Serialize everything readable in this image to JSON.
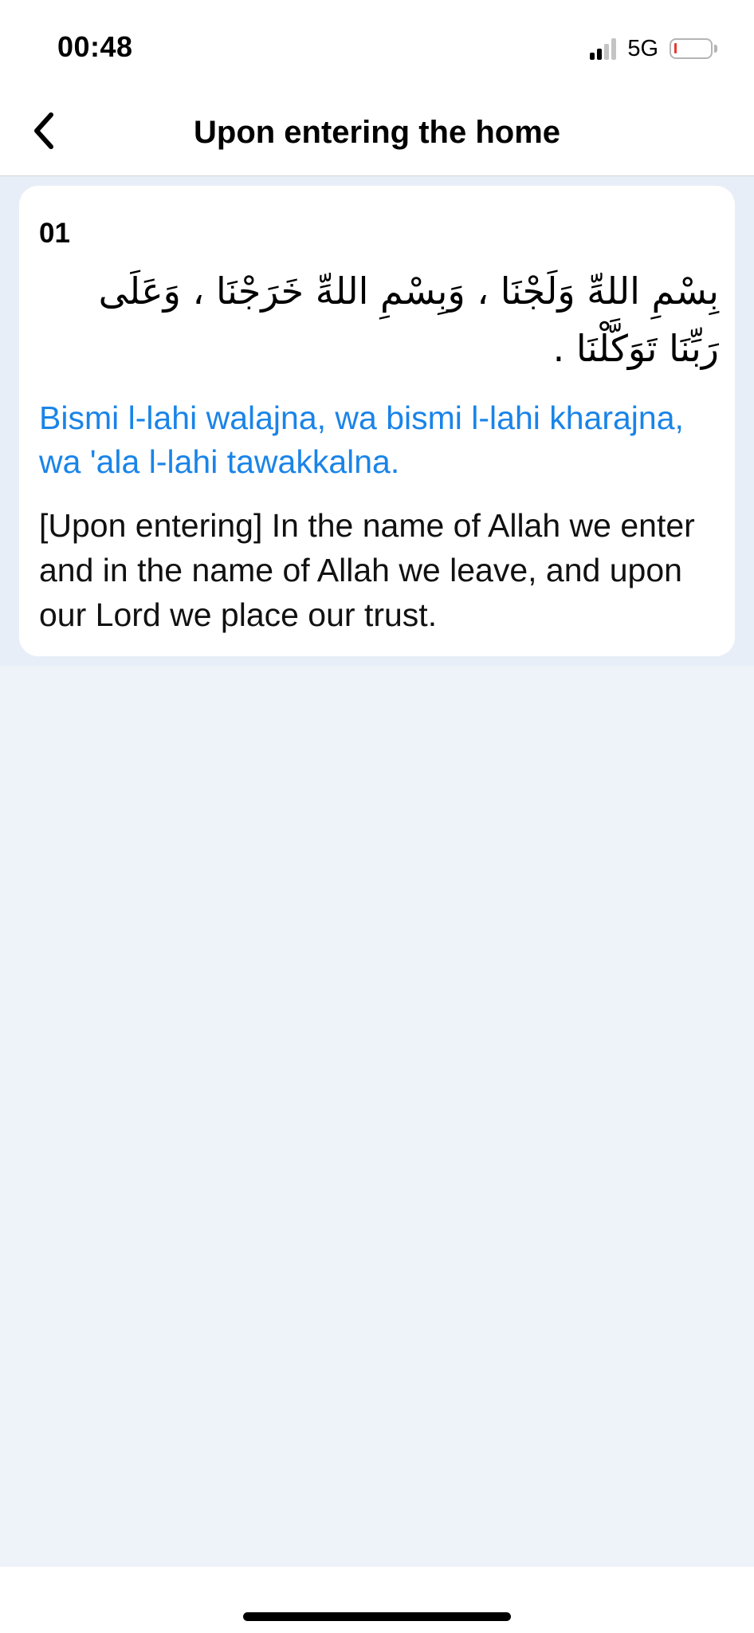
{
  "status_bar": {
    "time": "00:48",
    "network": "5G",
    "signal_strength": {
      "bars_active": 2,
      "bars_total": 4
    },
    "battery_level_fraction": 0.05,
    "battery_color": "#e53935"
  },
  "nav": {
    "back_icon": "chevron-left-icon",
    "title": "Upon entering the home"
  },
  "dua": {
    "number": "01",
    "arabic": "بِسْمِ اللهِّ وَلَجْنَا ، وَبِسْمِ اللهِّ خَرَجْنَا ، وَعَلَى رَبِّنَا تَوَكَّلْنَا .",
    "transliteration": "Bismi l-lahi walajna, wa bismi l-lahi kharajna, wa 'ala l-lahi tawakkalna.",
    "translation": "[Upon entering] In the name of Allah we enter and in the name of Allah we leave, and upon our Lord we place our trust."
  },
  "colors": {
    "accent": "#1a84e8",
    "background": "#eef3fa",
    "card": "#ffffff"
  }
}
